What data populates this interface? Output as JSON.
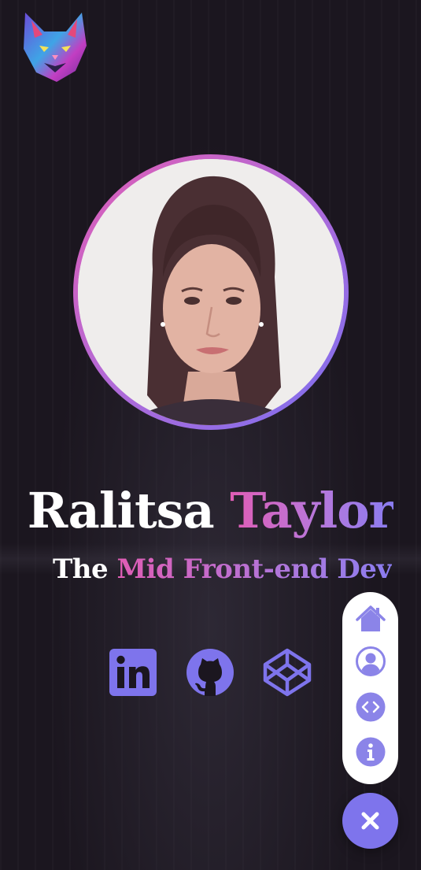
{
  "profile": {
    "first_name": "Ralitsa",
    "last_name": "Taylor",
    "title_prefix": "The",
    "title_accent": "Mid Front-end Dev"
  },
  "logo": {
    "icon": "cat-logo-icon"
  },
  "social": [
    {
      "icon": "linkedin-icon"
    },
    {
      "icon": "github-icon"
    },
    {
      "icon": "codepen-icon"
    }
  ],
  "nav": [
    {
      "icon": "home-icon"
    },
    {
      "icon": "user-icon"
    },
    {
      "icon": "code-icon"
    },
    {
      "icon": "info-icon"
    }
  ],
  "close": {
    "icon": "close-icon"
  },
  "colors": {
    "background": "#1b161f",
    "accent_pink": "#e05db5",
    "accent_purple": "#7b6ff0",
    "icon_purple": "#7e74ec",
    "nav_icon": "#8b84e8"
  }
}
